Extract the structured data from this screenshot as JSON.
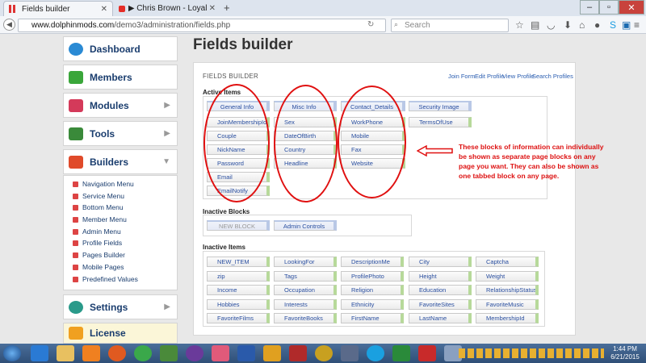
{
  "browser": {
    "tabs": [
      {
        "title": "Fields builder",
        "active": true
      },
      {
        "title": "▶ Chris Brown - Loyal (Exp...",
        "active": false
      }
    ],
    "url_domain": "www.dolphinmods.com",
    "url_path": "/demo3/administration/fields.php",
    "search_placeholder": "Search"
  },
  "sidebar": {
    "main": [
      {
        "label": "Dashboard",
        "color": "#2a8ad4"
      },
      {
        "label": "Members",
        "color": "#3aa63a"
      },
      {
        "label": "Modules",
        "color": "#d43a5a"
      },
      {
        "label": "Tools",
        "color": "#3a8a3a"
      },
      {
        "label": "Builders",
        "color": "#e04a2a"
      },
      {
        "label": "Settings",
        "color": "#2a9a8a"
      },
      {
        "label": "License",
        "color": "#f0a020"
      }
    ],
    "builders": [
      "Navigation Menu",
      "Service Menu",
      "Bottom Menu",
      "Member Menu",
      "Admin Menu",
      "Profile Fields",
      "Pages Builder",
      "Mobile Pages",
      "Predefined Values"
    ]
  },
  "page": {
    "title": "Fields builder",
    "panel_title": "FIELDS BUILDER",
    "links": [
      "Join Form",
      "Edit Profile",
      "View Profile",
      "Search Profiles"
    ]
  },
  "active": {
    "label": "Active Items",
    "columns": [
      {
        "head": "General Info",
        "items": [
          "JoinMembershipId",
          "Couple",
          "NickName",
          "Password",
          "Email",
          "EmailNotify"
        ]
      },
      {
        "head": "Misc Info",
        "items": [
          "Sex",
          "DateOfBirth",
          "Country",
          "Headline"
        ]
      },
      {
        "head": "Contact_Details",
        "items": [
          "WorkPhone",
          "Mobile",
          "Fax",
          "Website"
        ]
      },
      {
        "head": "Security Image",
        "items": [
          "TermsOfUse"
        ]
      }
    ]
  },
  "inactive_blocks": {
    "label": "Inactive Blocks",
    "items": [
      "NEW BLOCK",
      "Admin Controls"
    ]
  },
  "inactive_items": {
    "label": "Inactive Items",
    "rows": [
      [
        "NEW_ITEM",
        "LookingFor",
        "DescriptionMe",
        "City",
        "Captcha"
      ],
      [
        "zip",
        "Tags",
        "ProfilePhoto",
        "Height",
        "Weight"
      ],
      [
        "Income",
        "Occupation",
        "Religion",
        "Education",
        "RelationshipStatus"
      ],
      [
        "Hobbies",
        "Interests",
        "Ethnicity",
        "FavoriteSites",
        "FavoriteMusic"
      ],
      [
        "FavoriteFilms",
        "FavoriteBooks",
        "FirstName",
        "LastName",
        "MembershipId"
      ]
    ]
  },
  "annotation": "These blocks of information can individually be shown as separate page blocks on any page you want. They can also be shown as one tabbed block on any page.",
  "clock": {
    "time": "1:44 PM",
    "date": "6/21/2015"
  }
}
